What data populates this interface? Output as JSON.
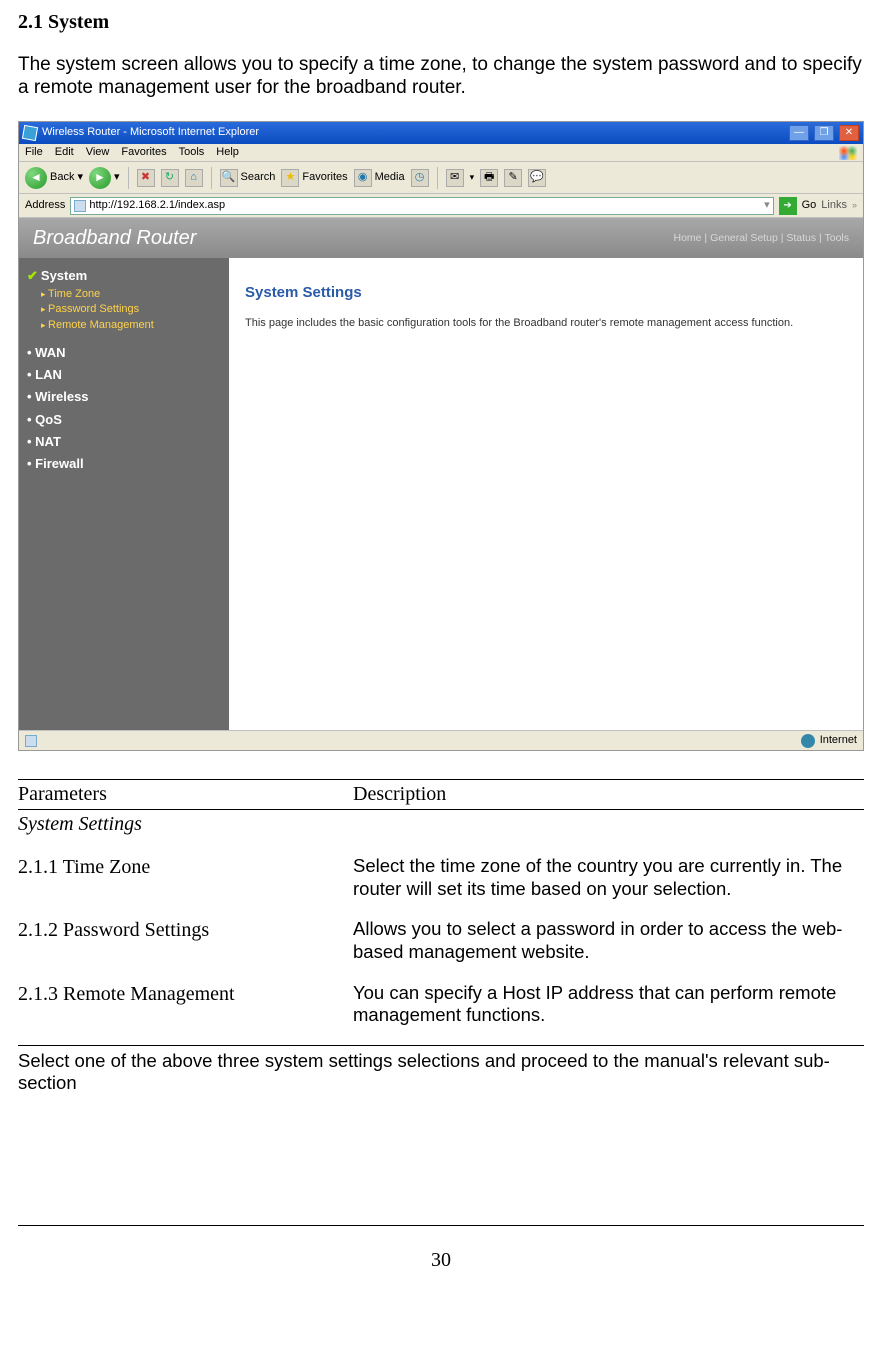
{
  "doc": {
    "section_title": "2.1 System",
    "intro": "The system screen allows you to specify a time zone, to change the system password and to specify a remote management user for the broadband router.",
    "closing": "Select one of the above three system settings selections and proceed to the manual's relevant sub-section",
    "page_number": "30"
  },
  "table": {
    "head_param": "Parameters",
    "head_desc": "Description",
    "subheading": "System Settings",
    "rows": [
      {
        "name": "2.1.1 Time Zone",
        "desc": "Select the time zone of the country you are currently in. The router will set its time based on your selection."
      },
      {
        "name": "2.1.2 Password Settings",
        "desc": "Allows you to select a password in order to access the web-based management website."
      },
      {
        "name": "2.1.3 Remote Management",
        "desc": "You can specify a Host IP address that can perform remote management functions."
      }
    ]
  },
  "screenshot": {
    "titlebar": "Wireless Router - Microsoft Internet Explorer",
    "menus": [
      "File",
      "Edit",
      "View",
      "Favorites",
      "Tools",
      "Help"
    ],
    "toolbar": {
      "back": "Back",
      "search": "Search",
      "favorites": "Favorites",
      "media": "Media"
    },
    "address_label": "Address",
    "address_url": "http://192.168.2.1/index.asp",
    "go_label": "Go",
    "links_label": "Links",
    "banner_title": "Broadband Router",
    "banner_links": "Home | General Setup | Status | Tools",
    "sidebar": {
      "selected": "System",
      "subitems": [
        "Time Zone",
        "Password Settings",
        "Remote Management"
      ],
      "maincats": [
        "WAN",
        "LAN",
        "Wireless",
        "QoS",
        "NAT",
        "Firewall"
      ]
    },
    "content": {
      "heading": "System Settings",
      "text": "This page includes the basic configuration tools for the Broadband router's remote management access function."
    },
    "statusbar": {
      "done": "",
      "zone": "Internet"
    }
  }
}
